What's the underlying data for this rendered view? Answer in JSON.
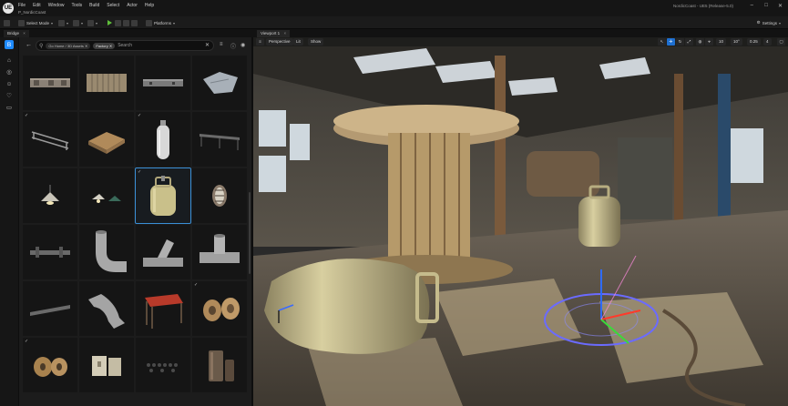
{
  "titlebar": {
    "logo": "UE",
    "menu": [
      "File",
      "Edit",
      "Window",
      "Tools",
      "Build",
      "Select",
      "Actor",
      "Help"
    ],
    "project": "P_NordicCoast",
    "window_title": "NordicCoast - UE5 (Release-5.0)",
    "minimize": "–",
    "maximize": "□",
    "close": "✕"
  },
  "toolbar": {
    "select_mode": "Select Mode",
    "platforms": "Platforms",
    "settings": "Settings"
  },
  "tabs": {
    "left": "Bridge",
    "viewport": "Viewport 1"
  },
  "library": {
    "chip_home": "Go Home / 3D Assets",
    "chip_factory": "Factory",
    "chip_close": "✕",
    "search_placeholder": "Search",
    "clear": "✕"
  },
  "viewport_bar": {
    "perspective": "Perspective",
    "lit": "Lit",
    "show": "Show",
    "grid_value": "10",
    "angle_value": "10°",
    "scale_value": "0.25",
    "camera_value": "4"
  },
  "colors": {
    "accent": "#1e8bff",
    "selection": "#3a8fd6"
  },
  "rail_icons": [
    "bridge-icon",
    "home-icon",
    "globe-icon",
    "user-icon",
    "heart-icon",
    "monitor-icon"
  ]
}
